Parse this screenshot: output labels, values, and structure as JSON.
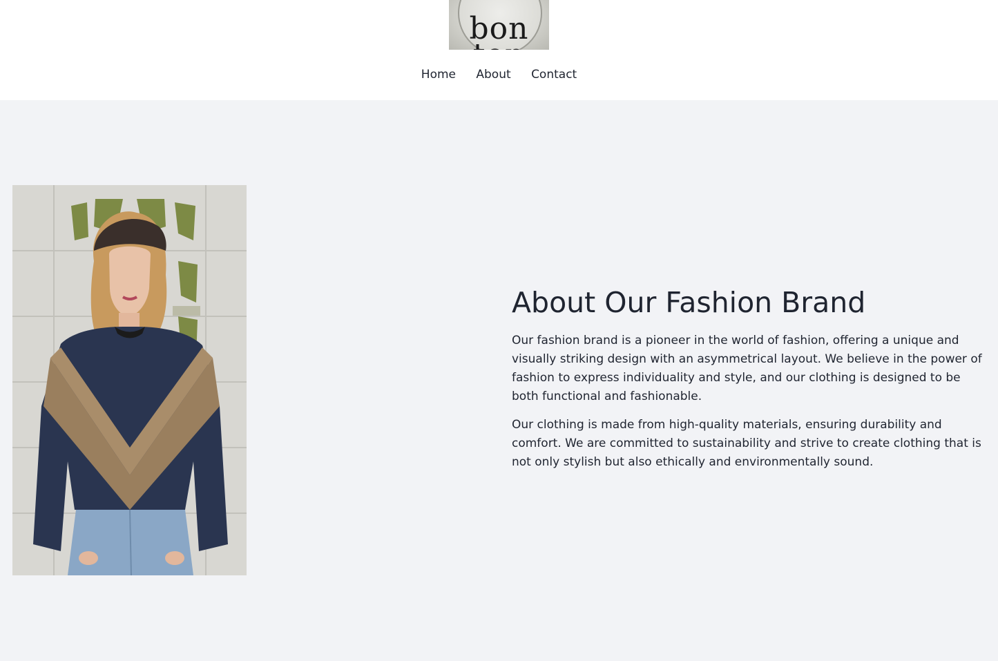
{
  "header": {
    "logo_text": "bon ton",
    "nav": [
      "Home",
      "About",
      "Contact"
    ]
  },
  "main": {
    "image_alt": "Model wearing navy and tan color-block jacket with light jeans",
    "title": "About Our Fashion Brand",
    "paragraphs": [
      "Our fashion brand is a pioneer in the world of fashion, offering a unique and visually striking design with an asymmetrical layout. We believe in the power of fashion to express individuality and style, and our clothing is designed to be both functional and fashionable.",
      "Our clothing is made from high-quality materials, ensuring durability and comfort. We are committed to sustainability and strive to create clothing that is not only stylish but also ethically and environmentally sound."
    ]
  },
  "colors": {
    "page_background": "#f2f3f6",
    "header_background": "#ffffff",
    "text": "#1f2430"
  }
}
